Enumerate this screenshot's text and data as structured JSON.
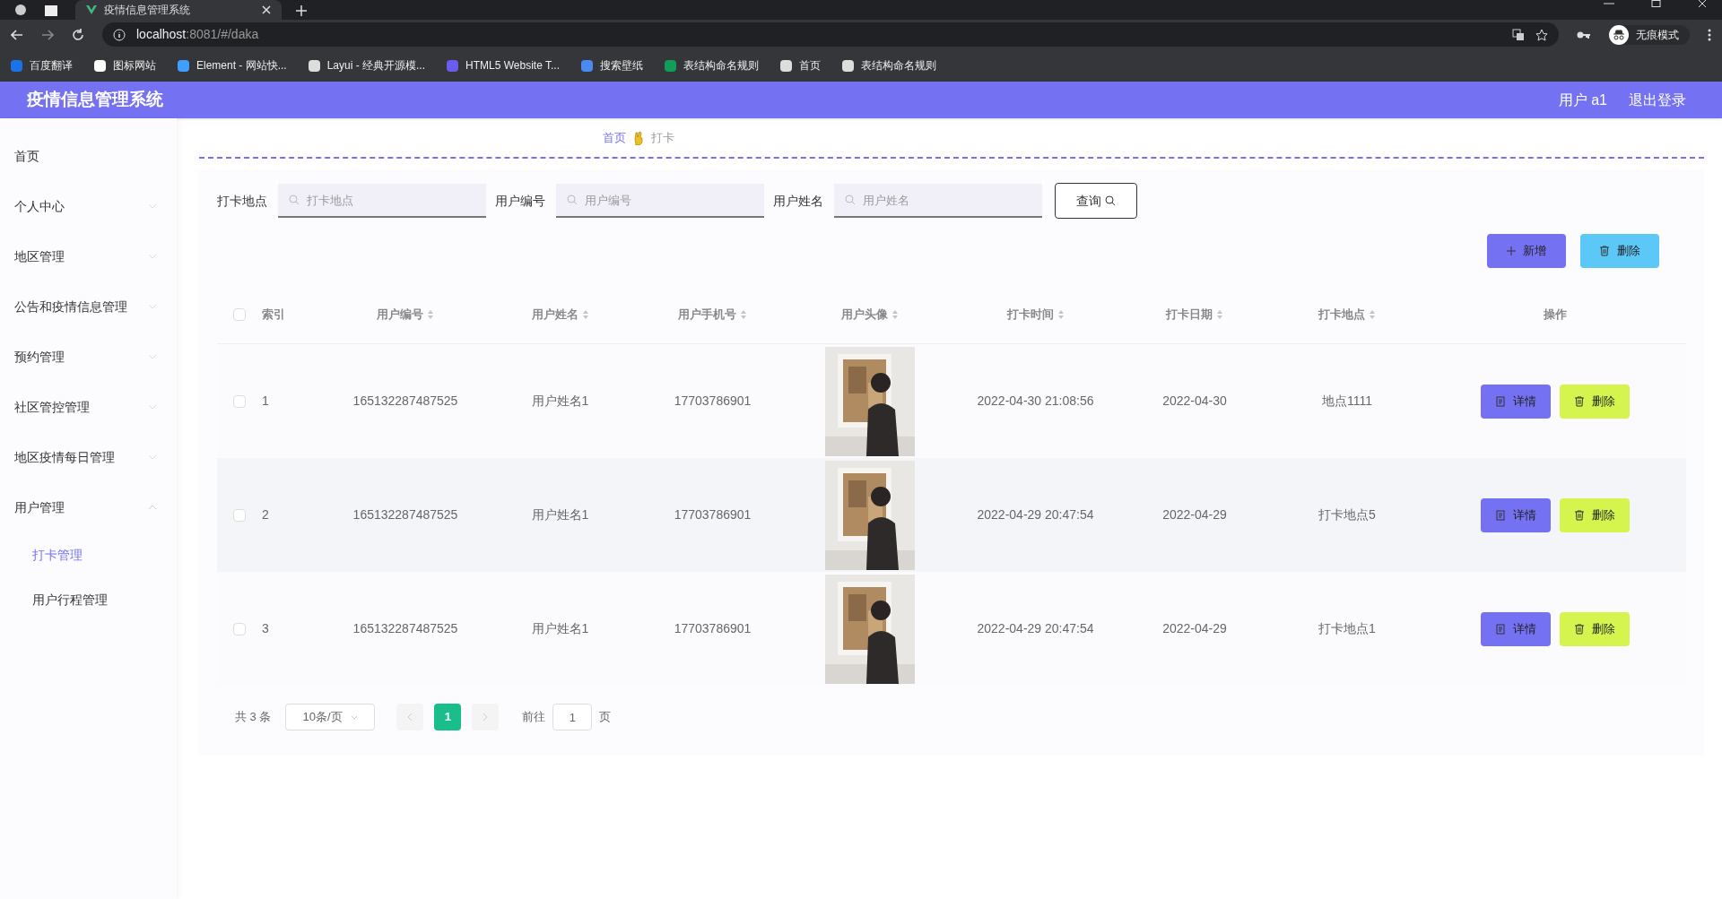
{
  "browser": {
    "tab_title": "疫情信息管理系统",
    "url_host": "localhost",
    "url_rest": ":8081/#/daka",
    "incognito": "无痕模式",
    "bookmarks": [
      {
        "label": "百度翻译",
        "color": "#1a73e8"
      },
      {
        "label": "图标网站",
        "color": "#ffffff"
      },
      {
        "label": "Element - 网站快...",
        "color": "#409eff"
      },
      {
        "label": "Layui - 经典开源模...",
        "color": "#dddddd"
      },
      {
        "label": "HTML5 Website T...",
        "color": "#6b5cf0"
      },
      {
        "label": "搜索壁纸",
        "color": "#4a8af4"
      },
      {
        "label": "表结构命名规则",
        "color": "#0f9d58"
      },
      {
        "label": "首页",
        "color": "#dddddd"
      },
      {
        "label": "表结构命名规则",
        "color": "#dddddd"
      }
    ]
  },
  "header": {
    "title": "疫情信息管理系统",
    "user": "用户 a1",
    "logout": "退出登录"
  },
  "sidebar": {
    "items": [
      {
        "label": "首页",
        "kind": "link"
      },
      {
        "label": "个人中心",
        "kind": "group",
        "expanded": false
      },
      {
        "label": "地区管理",
        "kind": "group",
        "expanded": false
      },
      {
        "label": "公告和疫情信息管理",
        "kind": "group",
        "expanded": false
      },
      {
        "label": "预约管理",
        "kind": "group",
        "expanded": false
      },
      {
        "label": "社区管控管理",
        "kind": "group",
        "expanded": false
      },
      {
        "label": "地区疫情每日管理",
        "kind": "group",
        "expanded": false
      },
      {
        "label": "用户管理",
        "kind": "group",
        "expanded": true,
        "children": [
          {
            "label": "打卡管理",
            "selected": true
          },
          {
            "label": "用户行程管理",
            "selected": false
          }
        ]
      }
    ]
  },
  "breadcrumb": {
    "home": "首页",
    "current": "打卡"
  },
  "search": {
    "fields": [
      {
        "label": "打卡地点",
        "placeholder": "打卡地点"
      },
      {
        "label": "用户编号",
        "placeholder": "用户编号"
      },
      {
        "label": "用户姓名",
        "placeholder": "用户姓名"
      }
    ],
    "query_button": "查询"
  },
  "actions": {
    "add": "新增",
    "delete": "删除"
  },
  "table": {
    "select_all": {
      "checked": false
    },
    "columns": [
      {
        "label": "索引",
        "sortable": false
      },
      {
        "label": "用户编号",
        "sortable": true
      },
      {
        "label": "用户姓名",
        "sortable": true
      },
      {
        "label": "用户手机号",
        "sortable": true
      },
      {
        "label": "用户头像",
        "sortable": true
      },
      {
        "label": "打卡时间",
        "sortable": true
      },
      {
        "label": "打卡日期",
        "sortable": true
      },
      {
        "label": "打卡地点",
        "sortable": true
      },
      {
        "label": "操作",
        "sortable": false
      }
    ],
    "rows": [
      {
        "checked": false,
        "index": "1",
        "user_no": "165132287487525",
        "user_name": "用户姓名1",
        "phone": "17703786901",
        "time": "2022-04-30 21:08:56",
        "date": "2022-04-30",
        "place": "地点1111",
        "detail": "详情",
        "delete": "删除"
      },
      {
        "checked": false,
        "index": "2",
        "user_no": "165132287487525",
        "user_name": "用户姓名1",
        "phone": "17703786901",
        "time": "2022-04-29 20:47:54",
        "date": "2022-04-29",
        "place": "打卡地点5",
        "detail": "详情",
        "delete": "删除"
      },
      {
        "checked": false,
        "index": "3",
        "user_no": "165132287487525",
        "user_name": "用户姓名1",
        "phone": "17703786901",
        "time": "2022-04-29 20:47:54",
        "date": "2022-04-29",
        "place": "打卡地点1",
        "detail": "详情",
        "delete": "删除"
      }
    ]
  },
  "pagination": {
    "total": "共 3 条",
    "page_size": "10条/页",
    "pages": [
      {
        "label": "1",
        "selected": true
      }
    ],
    "goto": "前往",
    "goto_value": "1",
    "page_unit": "页"
  }
}
